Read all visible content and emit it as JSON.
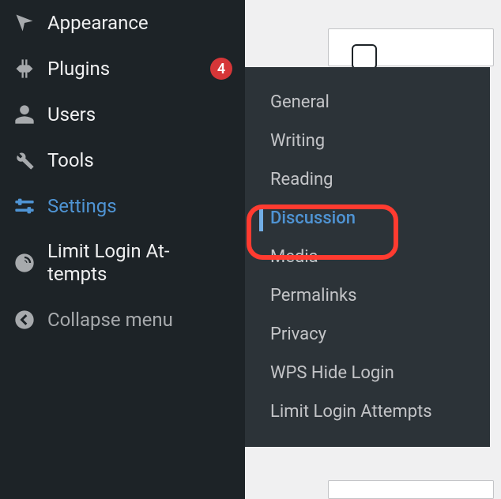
{
  "sidebar": {
    "items": [
      {
        "label": "Appearance",
        "icon": "appearance"
      },
      {
        "label": "Plugins",
        "icon": "plugins",
        "badge": "4"
      },
      {
        "label": "Users",
        "icon": "users"
      },
      {
        "label": "Tools",
        "icon": "tools"
      },
      {
        "label": "Settings",
        "icon": "settings"
      },
      {
        "label": "Limit Login At-\ntempts",
        "icon": "limit-login"
      },
      {
        "label": "Collapse menu",
        "icon": "collapse"
      }
    ]
  },
  "submenu": {
    "items": [
      {
        "label": "General"
      },
      {
        "label": "Writing"
      },
      {
        "label": "Reading"
      },
      {
        "label": "Discussion",
        "active": true
      },
      {
        "label": "Media"
      },
      {
        "label": "Permalinks"
      },
      {
        "label": "Privacy"
      },
      {
        "label": "WPS Hide Login"
      },
      {
        "label": "Limit Login Attempts"
      }
    ]
  }
}
